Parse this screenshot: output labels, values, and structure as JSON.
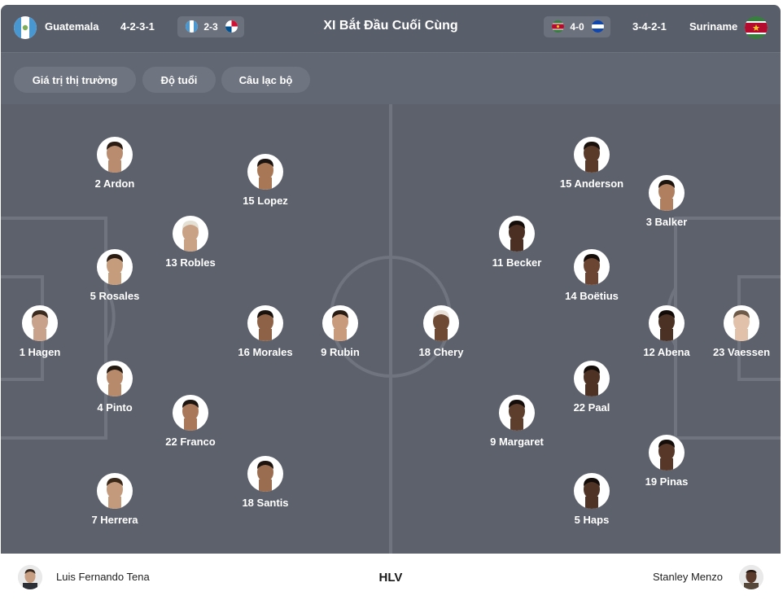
{
  "header": {
    "home_team": "Guatemala",
    "home_formation": "4-2-3-1",
    "home_recent_score": "2-3",
    "title": "XI Bắt Đầu Cuối Cùng",
    "away_recent_score": "4-0",
    "away_formation": "3-4-2-1",
    "away_team": "Suriname"
  },
  "filters": [
    "Giá trị thị trường",
    "Độ tuổi",
    "Câu lạc bộ"
  ],
  "home_players": [
    {
      "label": "2 Ardon",
      "skin": "#b98c6f",
      "hair": "#2b1d14"
    },
    {
      "label": "15 Lopez",
      "skin": "#a87856",
      "hair": "#1c1410"
    },
    {
      "label": "13 Robles",
      "skin": "#c9a184",
      "hair": "#e4e0d4"
    },
    {
      "label": "5 Rosales",
      "skin": "#c59c7c",
      "hair": "#2a1c12"
    },
    {
      "label": "1 Hagen",
      "skin": "#c8a28a",
      "hair": "#3b2a1e"
    },
    {
      "label": "16 Morales",
      "skin": "#8e6247",
      "hair": "#1a120d"
    },
    {
      "label": "9 Rubin",
      "skin": "#c99b7d",
      "hair": "#2a1b12"
    },
    {
      "label": "4 Pinto",
      "skin": "#b88a6c",
      "hair": "#251a12"
    },
    {
      "label": "22 Franco",
      "skin": "#a9785a",
      "hair": "#1d140f"
    },
    {
      "label": "7 Herrera",
      "skin": "#c49a7c",
      "hair": "#3a2818"
    },
    {
      "label": "18 Santis",
      "skin": "#9b6d50",
      "hair": "#1d140f"
    }
  ],
  "away_players": [
    {
      "label": "18 Chery",
      "skin": "#6e4a35",
      "hair": "#e8e0d6"
    },
    {
      "label": "15 Anderson",
      "skin": "#5a3b2a",
      "hair": "#1a110c"
    },
    {
      "label": "3 Balker",
      "skin": "#b07f60",
      "hair": "#1e140e"
    },
    {
      "label": "11 Becker",
      "skin": "#4a2f22",
      "hair": "#140d09"
    },
    {
      "label": "14 Boëtius",
      "skin": "#6b4532",
      "hair": "#140d09"
    },
    {
      "label": "12 Abena",
      "skin": "#4b3024",
      "hair": "#120b08"
    },
    {
      "label": "23 Vaessen",
      "skin": "#e2c1aa",
      "hair": "#6d5a48"
    },
    {
      "label": "22 Paal",
      "skin": "#4e3224",
      "hair": "#130c08"
    },
    {
      "label": "9 Margaret",
      "skin": "#5d3d2c",
      "hair": "#140d09"
    },
    {
      "label": "19 Pinas",
      "skin": "#573828",
      "hair": "#140d09"
    },
    {
      "label": "5 Haps",
      "skin": "#4f3325",
      "hair": "#130c08"
    }
  ],
  "coach": {
    "home_name": "Luis Fernando Tena",
    "label": "HLV",
    "away_name": "Stanley Menzo"
  },
  "colors": {
    "header_bg": "#595f6a",
    "filter_bg": "#626873",
    "pitch_bg": "#5c616c",
    "pitch_lines": "#6f747e"
  }
}
